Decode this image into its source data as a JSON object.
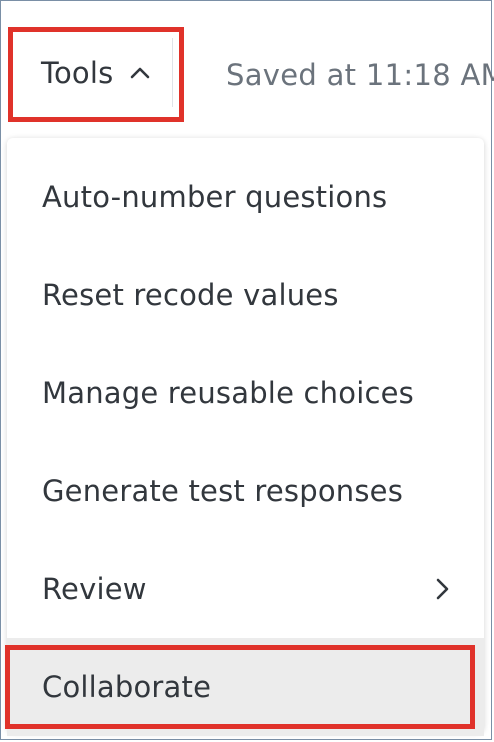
{
  "toolbar": {
    "tools_label": "Tools",
    "tools_icon": "chevron-up-icon",
    "saved_status": "Saved at 11:18 AM"
  },
  "menu": {
    "items": [
      {
        "label": "Auto-number questions"
      },
      {
        "label": "Reset recode values"
      },
      {
        "label": "Manage reusable choices"
      },
      {
        "label": "Generate test responses"
      },
      {
        "label": "Review",
        "submenu_icon": "chevron-right-icon"
      },
      {
        "label": "Collaborate",
        "highlighted": true
      }
    ]
  },
  "colors": {
    "annotation_red": "#e0322a",
    "text": "#32373d",
    "muted_text": "#6b737c",
    "hover_bg": "#ececec"
  }
}
